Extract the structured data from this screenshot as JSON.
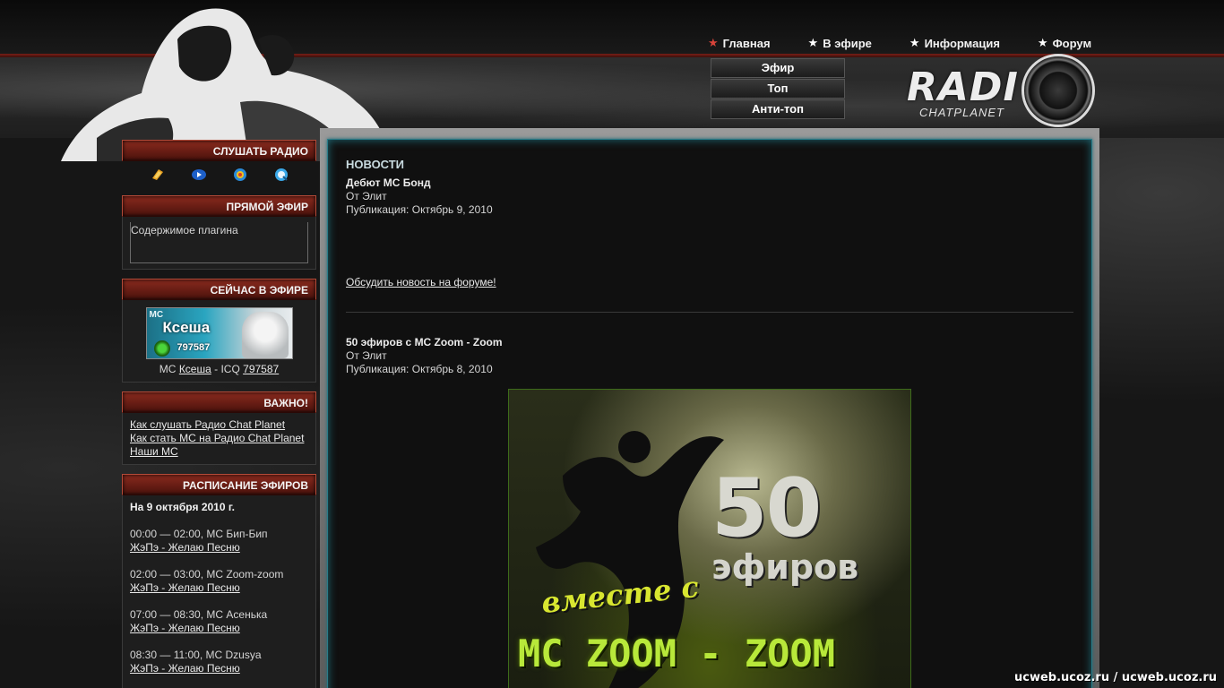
{
  "topnav": [
    {
      "label": "Главная",
      "active": true
    },
    {
      "label": "В эфире",
      "active": false
    },
    {
      "label": "Информация",
      "active": false
    },
    {
      "label": "Форум",
      "active": false
    }
  ],
  "subnav": [
    "Эфир",
    "Топ",
    "Анти-топ"
  ],
  "logo": {
    "word": "RADI",
    "sub": "CHATPLANET"
  },
  "sidebar": {
    "listen": {
      "title": "СЛУШАТЬ РАДИО",
      "players": [
        "winamp-icon",
        "windows-media-icon",
        "realplayer-icon",
        "quicktime-icon"
      ]
    },
    "live": {
      "title": "ПРЯМОЙ ЭФИР",
      "plugin_text": "Содержимое плагина"
    },
    "now": {
      "title": "СЕЙЧАС В ЭФИРЕ",
      "banner_mc": "MC",
      "banner_name": "Ксеша",
      "banner_icq": "797587",
      "prefix": "МС",
      "name": "Ксеша",
      "icq_label": "- ICQ",
      "icq": "797587"
    },
    "important": {
      "title": "ВАЖНО!",
      "links": [
        "Как слушать Радио Chat Planet",
        "Как стать МС на Радио Chat Planet",
        "Наши МС"
      ]
    },
    "schedule": {
      "title": "РАСПИСАНИЕ ЭФИРОВ",
      "date": "На 9 октября 2010 г.",
      "slots": [
        {
          "time": "00:00 — 02:00, МС Бип-Бип",
          "link": "ЖэПэ - Желаю Песню"
        },
        {
          "time": "02:00 — 03:00, МС Zoom-zoom",
          "link": "ЖэПэ - Желаю Песню"
        },
        {
          "time": "07:00 — 08:30, МС Асенька",
          "link": "ЖэПэ - Желаю Песню"
        },
        {
          "time": "08:30 — 11:00, МС Dzusya",
          "link": "ЖэПэ - Желаю Песню"
        }
      ]
    }
  },
  "news": {
    "title": "НОВОСТИ",
    "posts": [
      {
        "title": "Дебют МС Бонд",
        "author": "От Элит",
        "date": "Публикация: Октябрь 9, 2010",
        "link": "Обсудить новость на форуме!"
      },
      {
        "title": "50 эфиров с MC Zoom - Zoom",
        "author": "От Элит",
        "date": "Публикация: Октябрь 8, 2010"
      }
    ],
    "poster": {
      "num": "50",
      "efir": "эфиров",
      "with": "вместе с",
      "mczoom": "MC  ZOOM - ZOOM"
    }
  },
  "watermark": "ucweb.ucoz.ru / ucweb.ucoz.ru"
}
